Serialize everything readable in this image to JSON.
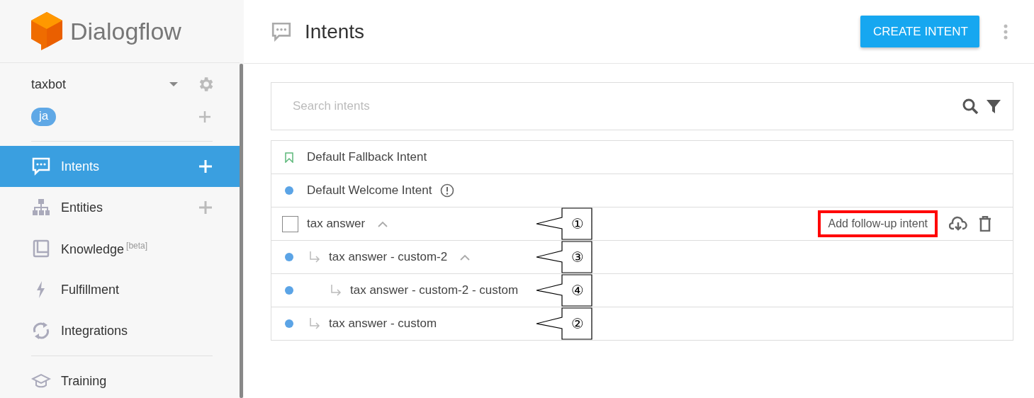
{
  "logo": {
    "text": "Dialogflow"
  },
  "agent": {
    "name": "taxbot",
    "language": "ja"
  },
  "nav": [
    {
      "label": "Intents",
      "selected": true,
      "add": true
    },
    {
      "label": "Entities",
      "selected": false,
      "add": true
    },
    {
      "label": "Knowledge",
      "sup": "[beta]",
      "selected": false,
      "add": false
    },
    {
      "label": "Fulfillment",
      "selected": false,
      "add": false
    },
    {
      "label": "Integrations",
      "selected": false,
      "add": false
    }
  ],
  "nav_secondary": [
    {
      "label": "Training",
      "selected": false
    }
  ],
  "header": {
    "title": "Intents",
    "button": "CREATE INTENT"
  },
  "search": {
    "placeholder": "Search intents"
  },
  "intents": [
    {
      "name": "Default Fallback Intent",
      "kind": "fallback"
    },
    {
      "name": "Default Welcome Intent",
      "kind": "dot",
      "warning": true
    },
    {
      "name": "tax answer",
      "kind": "checkbox",
      "checked": false,
      "expanded": true,
      "callout": "①",
      "action": {
        "label": "Add follow-up intent",
        "highlighted": true
      },
      "children": [
        {
          "name": "tax answer - custom-2",
          "kind": "dot",
          "expanded": true,
          "callout": "③",
          "children": [
            {
              "name": "tax answer - custom-2 - custom",
              "kind": "dot",
              "callout": "④"
            }
          ]
        },
        {
          "name": "tax answer - custom",
          "kind": "dot",
          "callout": "②"
        }
      ]
    }
  ]
}
